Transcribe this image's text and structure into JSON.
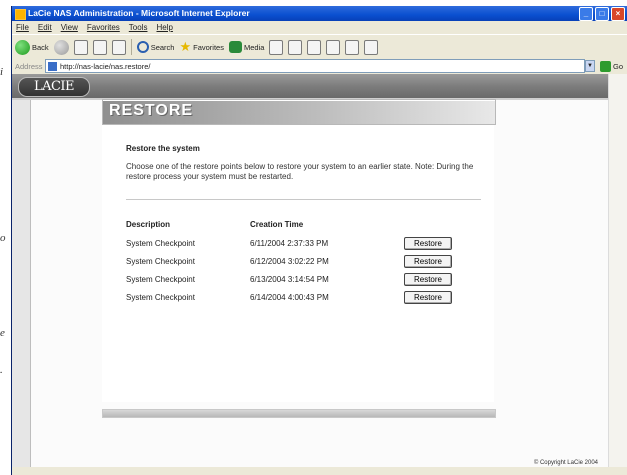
{
  "window": {
    "title": "LaCie NAS Administration - Microsoft Internet Explorer",
    "buttons": [
      "_",
      "□",
      "×"
    ]
  },
  "menu": [
    "File",
    "Edit",
    "View",
    "Favorites",
    "Tools",
    "Help"
  ],
  "toolbar": {
    "back_label": "Back",
    "search_label": "Search",
    "favorites_label": "Favorites",
    "media_label": "Media"
  },
  "address": {
    "label": "Address",
    "url": "http://nas-lacie/nas.restore/",
    "go_label": "Go"
  },
  "brand": {
    "logo_text": "LACIE"
  },
  "edge_text": [
    "i",
    "o",
    "e",
    "."
  ],
  "restore": {
    "header": "RESTORE",
    "section_title": "Restore the system",
    "description": "Choose one of the restore points below to restore your system to an earlier state. Note: During the restore process your system must be restarted.",
    "columns": {
      "description": "Description",
      "time": "Creation Time"
    },
    "button_label": "Restore",
    "rows": [
      {
        "description": "System Checkpoint",
        "time": "6/11/2004 2:37:33 PM"
      },
      {
        "description": "System Checkpoint",
        "time": "6/12/2004 3:02:22 PM"
      },
      {
        "description": "System Checkpoint",
        "time": "6/13/2004 3:14:54 PM"
      },
      {
        "description": "System Checkpoint",
        "time": "6/14/2004 4:00:43 PM"
      }
    ]
  },
  "status": {
    "copyright": "© Copyright LaCie 2004"
  },
  "colors": {
    "titlebar": "#0a4fd0",
    "chrome": "#ece9d8",
    "brand_bar": "#7d7d7d"
  }
}
